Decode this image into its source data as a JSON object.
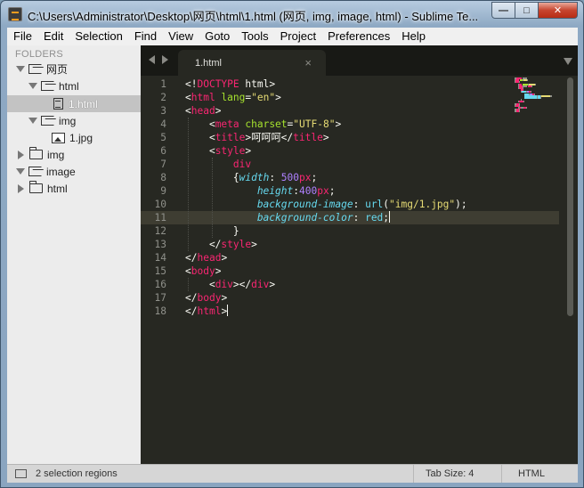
{
  "window": {
    "title": "C:\\Users\\Administrator\\Desktop\\网页\\html\\1.html (网页, img, image, html) - Sublime Te...",
    "controls": {
      "minimize": "—",
      "maximize": "□",
      "close": "✕"
    }
  },
  "menu": [
    "File",
    "Edit",
    "Selection",
    "Find",
    "View",
    "Goto",
    "Tools",
    "Project",
    "Preferences",
    "Help"
  ],
  "sidebar": {
    "header": "FOLDERS",
    "tree": [
      {
        "label": "网页",
        "kind": "folder-open",
        "level": 0,
        "expanded": true
      },
      {
        "label": "html",
        "kind": "folder-open",
        "level": 1,
        "expanded": true
      },
      {
        "label": "1.html",
        "kind": "file",
        "level": 2,
        "selected": true
      },
      {
        "label": "img",
        "kind": "folder-open",
        "level": 1,
        "expanded": true
      },
      {
        "label": "1.jpg",
        "kind": "image",
        "level": 2
      },
      {
        "label": "img",
        "kind": "folder",
        "level": 0,
        "expanded": false
      },
      {
        "label": "image",
        "kind": "folder-open",
        "level": 0,
        "expanded": true
      },
      {
        "label": "html",
        "kind": "folder",
        "level": 0,
        "expanded": false
      }
    ]
  },
  "tab": {
    "label": "1.html",
    "close": "×"
  },
  "editor": {
    "current_line": 11,
    "lines": [
      [
        [
          "t-punct",
          "<!"
        ],
        [
          "t-tag",
          "DOCTYPE"
        ],
        [
          "t-punct",
          " html>"
        ]
      ],
      [
        [
          "t-punct",
          "<"
        ],
        [
          "t-tag",
          "html"
        ],
        [
          "t-attr",
          " lang"
        ],
        [
          "t-punct",
          "="
        ],
        [
          "t-str",
          "\"en\""
        ],
        [
          "t-punct",
          ">"
        ]
      ],
      [
        [
          "t-punct",
          "<"
        ],
        [
          "t-tag",
          "head"
        ],
        [
          "t-punct",
          ">"
        ]
      ],
      [
        [
          "t-punct",
          "    <"
        ],
        [
          "t-tag",
          "meta"
        ],
        [
          "t-attr",
          " charset"
        ],
        [
          "t-punct",
          "="
        ],
        [
          "t-str",
          "\"UTF-8\""
        ],
        [
          "t-punct",
          ">"
        ]
      ],
      [
        [
          "t-punct",
          "    <"
        ],
        [
          "t-tag",
          "title"
        ],
        [
          "t-punct",
          ">呵呵呵</"
        ],
        [
          "t-tag",
          "title"
        ],
        [
          "t-punct",
          ">"
        ]
      ],
      [
        [
          "t-punct",
          "    <"
        ],
        [
          "t-tag",
          "style"
        ],
        [
          "t-punct",
          ">"
        ]
      ],
      [
        [
          "t-tag",
          "        div"
        ]
      ],
      [
        [
          "t-punct",
          "        {"
        ],
        [
          "t-prop",
          "width"
        ],
        [
          "t-punct",
          ": "
        ],
        [
          "t-num",
          "500"
        ],
        [
          "t-tag",
          "px"
        ],
        [
          "t-punct",
          ";"
        ]
      ],
      [
        [
          "t-prop",
          "            height"
        ],
        [
          "t-punct",
          ":"
        ],
        [
          "t-num",
          "400"
        ],
        [
          "t-tag",
          "px"
        ],
        [
          "t-punct",
          ";"
        ]
      ],
      [
        [
          "t-prop",
          "            background-image"
        ],
        [
          "t-punct",
          ": "
        ],
        [
          "t-val",
          "url"
        ],
        [
          "t-punct",
          "("
        ],
        [
          "t-str",
          "\"img/1.jpg\""
        ],
        [
          "t-punct",
          ");"
        ]
      ],
      [
        [
          "t-prop",
          "            background-color"
        ],
        [
          "t-punct",
          ": "
        ],
        [
          "t-val",
          "red"
        ],
        [
          "t-punct",
          ";"
        ]
      ],
      [
        [
          "t-punct",
          "        }"
        ]
      ],
      [
        [
          "t-punct",
          "    </"
        ],
        [
          "t-tag",
          "style"
        ],
        [
          "t-punct",
          ">"
        ]
      ],
      [
        [
          "t-punct",
          "</"
        ],
        [
          "t-tag",
          "head"
        ],
        [
          "t-punct",
          ">"
        ]
      ],
      [
        [
          "t-punct",
          "<"
        ],
        [
          "t-tag",
          "body"
        ],
        [
          "t-punct",
          ">"
        ]
      ],
      [
        [
          "t-punct",
          "    <"
        ],
        [
          "t-tag",
          "div"
        ],
        [
          "t-punct",
          "></"
        ],
        [
          "t-tag",
          "div"
        ],
        [
          "t-punct",
          ">"
        ]
      ],
      [
        [
          "t-punct",
          "</"
        ],
        [
          "t-tag",
          "body"
        ],
        [
          "t-punct",
          ">"
        ]
      ],
      [
        [
          "t-punct",
          "</"
        ],
        [
          "t-tag",
          "html"
        ],
        [
          "t-punct",
          ">"
        ]
      ]
    ]
  },
  "status": {
    "message": "2 selection regions",
    "tab_size": "Tab Size: 4",
    "syntax": "HTML"
  }
}
